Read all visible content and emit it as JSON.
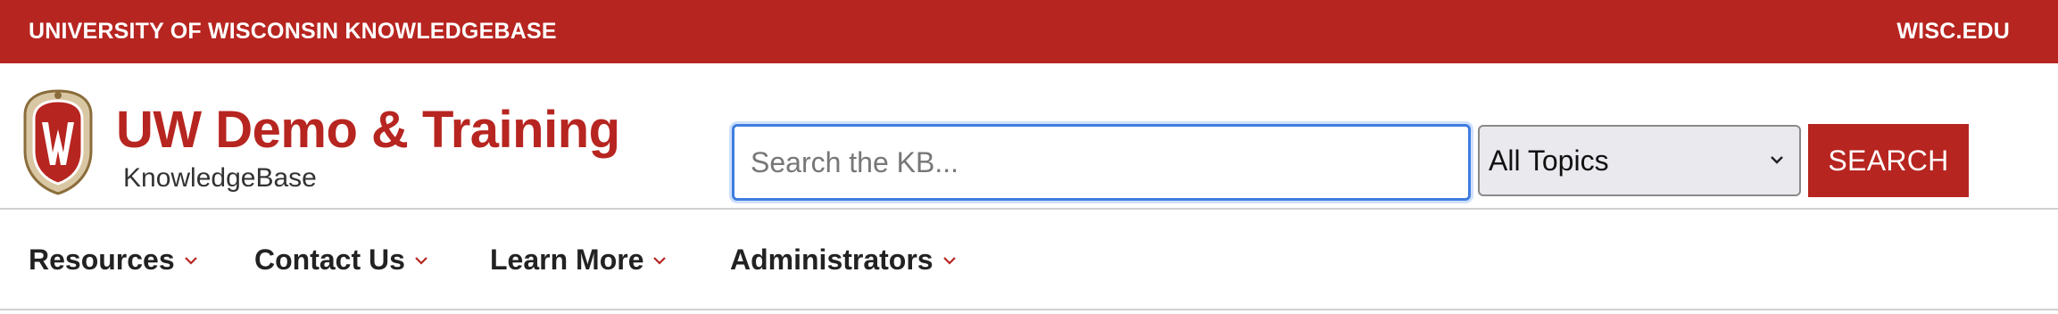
{
  "topbar": {
    "brand": "UNIVERSITY OF WISCONSIN KNOWLEDGEBASE",
    "link": "WISC.EDU"
  },
  "header": {
    "logo_icon": "uw-crest-icon",
    "title": "UW Demo & Training",
    "subtitle": "KnowledgeBase"
  },
  "search": {
    "placeholder": "Search the KB...",
    "value": "",
    "topic_selected": "All Topics",
    "button_label": "SEARCH"
  },
  "nav": {
    "items": [
      {
        "label": "Resources",
        "icon": "chevron-down-icon"
      },
      {
        "label": "Contact Us",
        "icon": "chevron-down-icon"
      },
      {
        "label": "Learn More",
        "icon": "chevron-down-icon"
      },
      {
        "label": "Administrators",
        "icon": "chevron-down-icon"
      }
    ]
  },
  "colors": {
    "brand_red": "#b72520",
    "focus_blue": "#3f7de0",
    "text_dark": "#222222"
  }
}
